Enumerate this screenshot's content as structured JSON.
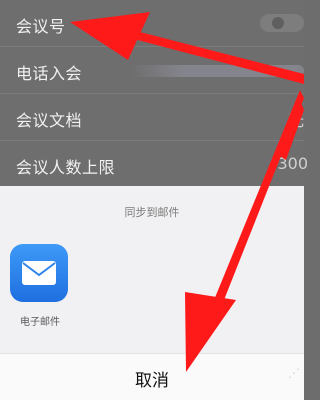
{
  "settings": {
    "rows": [
      {
        "label": "会议号",
        "right": ""
      },
      {
        "label": "电话入会",
        "right": ""
      },
      {
        "label": "会议文档",
        "right": "无"
      },
      {
        "label": "会议人数上限",
        "right": "300"
      }
    ]
  },
  "share_sheet": {
    "title": "同步到邮件",
    "app_label": "电子邮件",
    "app_icon": "mail-icon",
    "cancel_label": "取消"
  },
  "annotation": {
    "arrow_color": "#ff1a1a"
  }
}
